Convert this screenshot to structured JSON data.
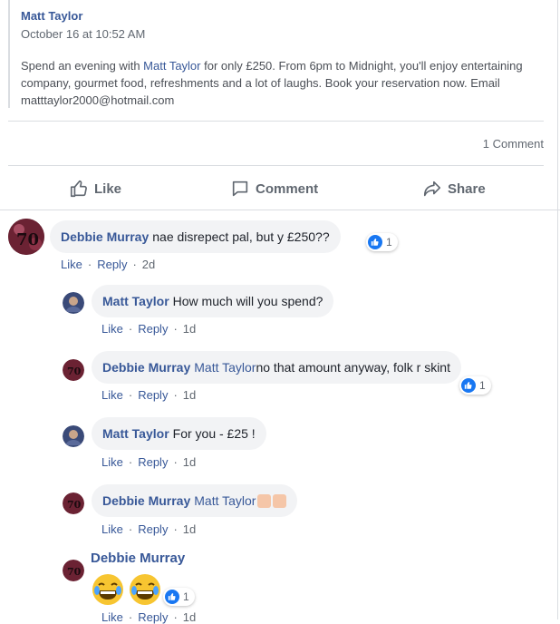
{
  "post": {
    "author": "Matt Taylor",
    "timestamp": "October 16 at 10:52 AM",
    "text_before": "Spend an evening with ",
    "text_link": "Matt Taylor",
    "text_after": " for only £250. From 6pm to Midnight, you'll enjoy entertaining company, gourmet food, refreshments and a lot of laughs. Book your reservation now. Email matttaylor2000@hotmail.com",
    "comment_count": "1 Comment"
  },
  "actions": {
    "like": "Like",
    "comment": "Comment",
    "share": "Share"
  },
  "comments": [
    {
      "author": "Debbie Murray",
      "text": "nae disrepect pal, but y £250??",
      "reactions": "1",
      "time": "2d"
    },
    {
      "author": "Matt Taylor",
      "text": "How much will you spend?",
      "time": "1d"
    },
    {
      "author": "Debbie Murray",
      "tag": "Matt Taylor",
      "text": "no that amount anyway, folk r skint",
      "reactions": "1",
      "time": "1d"
    },
    {
      "author": "Matt Taylor",
      "text": "For you - £25 !",
      "time": "1d"
    },
    {
      "author": "Debbie Murray",
      "tag": "Matt Taylor",
      "text": "",
      "time": "1d"
    },
    {
      "author": "Debbie Murray",
      "text": "",
      "reactions": "1",
      "time": "1d"
    }
  ],
  "meta_labels": {
    "like": "Like",
    "reply": "Reply",
    "sep": "·"
  },
  "icons": {
    "like": "thumbs-up-icon",
    "comment": "speech-bubble-icon",
    "share": "share-arrow-icon",
    "reaction": "like-reaction-icon",
    "emoji_1": "pointing-hand-emoji",
    "emoji_2": "laughing-emoji"
  },
  "colors": {
    "brand_link": "#385898",
    "like_blue": "#1877f2",
    "bubble": "#f2f3f5"
  }
}
